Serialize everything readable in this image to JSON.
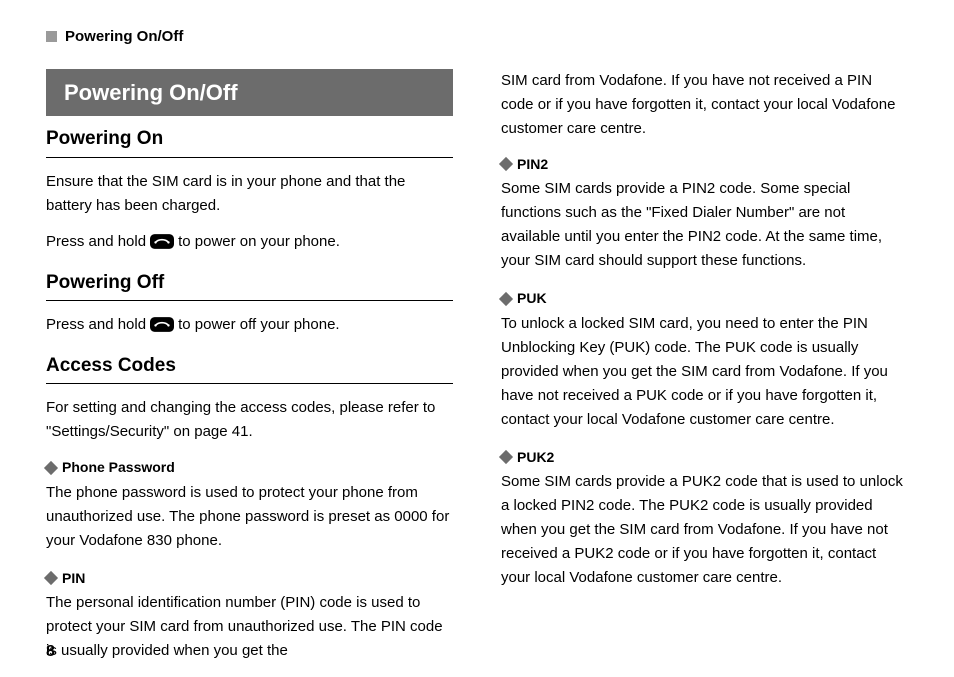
{
  "running_head": "Powering On/Off",
  "page_number": "8",
  "left": {
    "title": "Powering On/Off",
    "sections": [
      {
        "heading": "Powering On",
        "para1": "Ensure that the SIM card is in your phone and that the battery has been charged.",
        "press_before": "Press and hold",
        "press_after": "to power on your phone."
      },
      {
        "heading": "Powering Off",
        "press_before": "Press and hold",
        "press_after": "to power off your phone."
      },
      {
        "heading": "Access Codes",
        "para": "For setting and changing the access codes, please refer to \"Settings/Security\" on page 41."
      }
    ],
    "items": [
      {
        "label": "Phone Password",
        "body": "The phone password is used to protect your phone from unauthorized use. The phone password is preset as 0000 for your Vodafone 830 phone."
      },
      {
        "label": "PIN",
        "body": "The personal identification number (PIN) code is used to protect your SIM card from unauthorized use. The PIN code is usually provided when you get the"
      }
    ]
  },
  "right": {
    "continuation": "SIM card from Vodafone. If you have not received a PIN code or if you have forgotten it, contact your local Vodafone customer care centre.",
    "items": [
      {
        "label": "PIN2",
        "body": "Some SIM cards provide a PIN2 code. Some special functions such as the \"Fixed Dialer Number\" are not available until you enter the PIN2 code. At the same time, your SIM card should support these functions."
      },
      {
        "label": "PUK",
        "body": "To unlock a locked SIM card, you need to enter the PIN Unblocking Key (PUK) code. The PUK code is usually provided when you get the SIM card from Vodafone. If you have not received a PUK code or if you have forgotten it, contact your local Vodafone customer care centre."
      },
      {
        "label": "PUK2",
        "body": "Some SIM cards provide a PUK2 code that is used to unlock a locked PIN2 code. The PUK2 code is usually provided when you get the SIM card from Vodafone. If you have not received a PUK2 code or if you have forgotten it, contact your local Vodafone customer care centre."
      }
    ]
  }
}
